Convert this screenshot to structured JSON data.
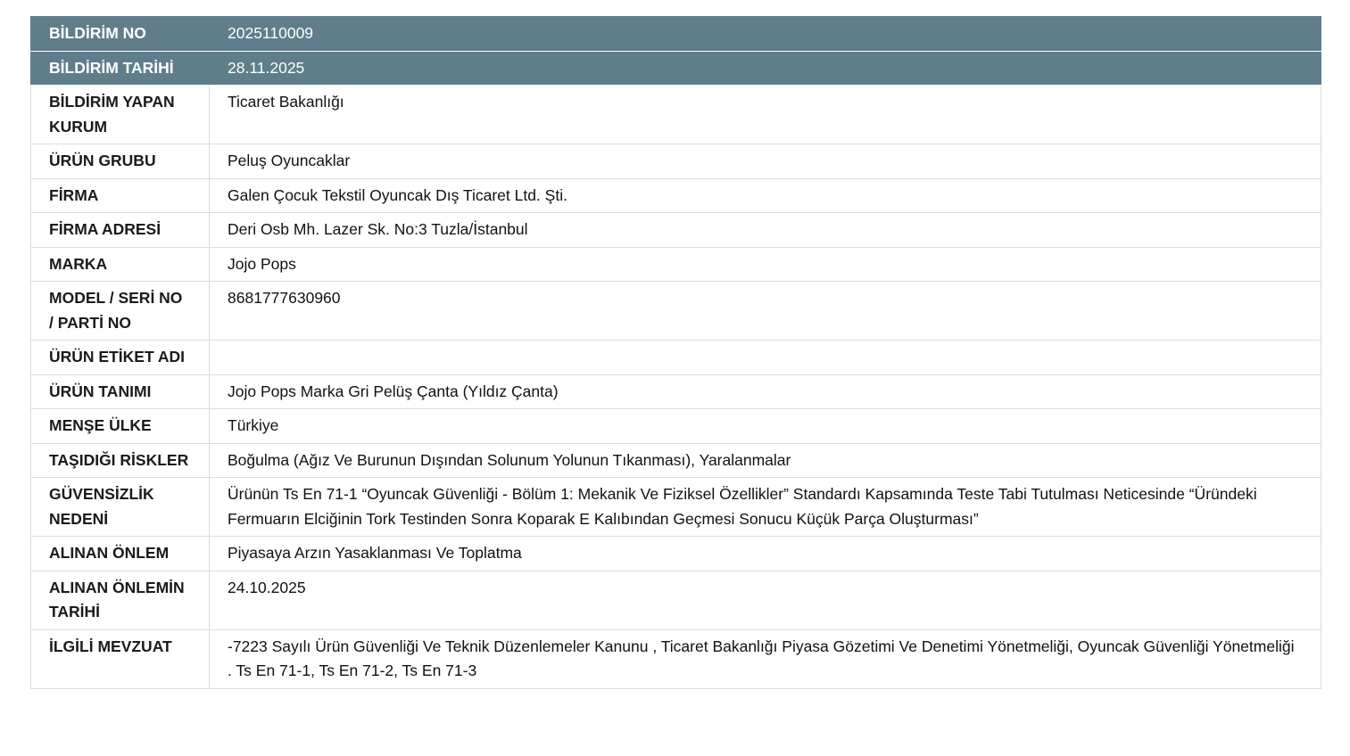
{
  "rows": [
    {
      "label": "BİLDİRİM NO",
      "value": "2025110009",
      "header": true
    },
    {
      "label": "BİLDİRİM TARİHİ",
      "value": "28.11.2025",
      "header": true
    },
    {
      "label": "BİLDİRİM YAPAN KURUM",
      "value": "Ticaret Bakanlığı"
    },
    {
      "label": "ÜRÜN GRUBU",
      "value": "Peluş Oyuncaklar"
    },
    {
      "label": "FİRMA",
      "value": "Galen Çocuk Tekstil Oyuncak Dış Ticaret Ltd. Şti."
    },
    {
      "label": "FİRMA ADRESİ",
      "value": "Deri Osb Mh. Lazer Sk. No:3 Tuzla/İstanbul"
    },
    {
      "label": "MARKA",
      "value": "Jojo Pops"
    },
    {
      "label": "MODEL / SERİ NO / PARTİ NO",
      "value": "8681777630960"
    },
    {
      "label": "ÜRÜN ETİKET ADI",
      "value": ""
    },
    {
      "label": "ÜRÜN TANIMI",
      "value": "Jojo Pops Marka Gri Pelüş Çanta (Yıldız Çanta)"
    },
    {
      "label": "MENŞE ÜLKE",
      "value": "Türkiye"
    },
    {
      "label": "TAŞIDIĞI RİSKLER",
      "value": "Boğulma (Ağız Ve Burunun Dışından Solunum Yolunun Tıkanması), Yaralanmalar"
    },
    {
      "label": "GÜVENSİZLİK NEDENİ",
      "value": "Ürünün Ts En 71-1 “Oyuncak Güvenliği - Bölüm 1: Mekanik Ve Fiziksel Özellikler” Standardı Kapsamında Teste Tabi Tutulması Neticesinde “Üründeki Fermuarın Elciğinin Tork Testinden Sonra Koparak E Kalıbından Geçmesi Sonucu Küçük Parça Oluşturması”"
    },
    {
      "label": "ALINAN ÖNLEM",
      "value": "Piyasaya Arzın Yasaklanması Ve Toplatma"
    },
    {
      "label": "ALINAN ÖNLEMİN TARİHİ",
      "value": "24.10.2025"
    },
    {
      "label": "İLGİLİ MEVZUAT",
      "value": "-7223 Sayılı Ürün Güvenliği Ve Teknik Düzenlemeler Kanunu , Ticaret Bakanlığı Piyasa Gözetimi Ve Denetimi Yönetmeliği, Oyuncak Güvenliği Yönetmeliği . Ts En 71-1, Ts En 71-2, Ts En 71-3"
    }
  ],
  "colors": {
    "header_bg": "#607d8b",
    "header_text": "#ffffff",
    "border": "#dcdcdc"
  }
}
